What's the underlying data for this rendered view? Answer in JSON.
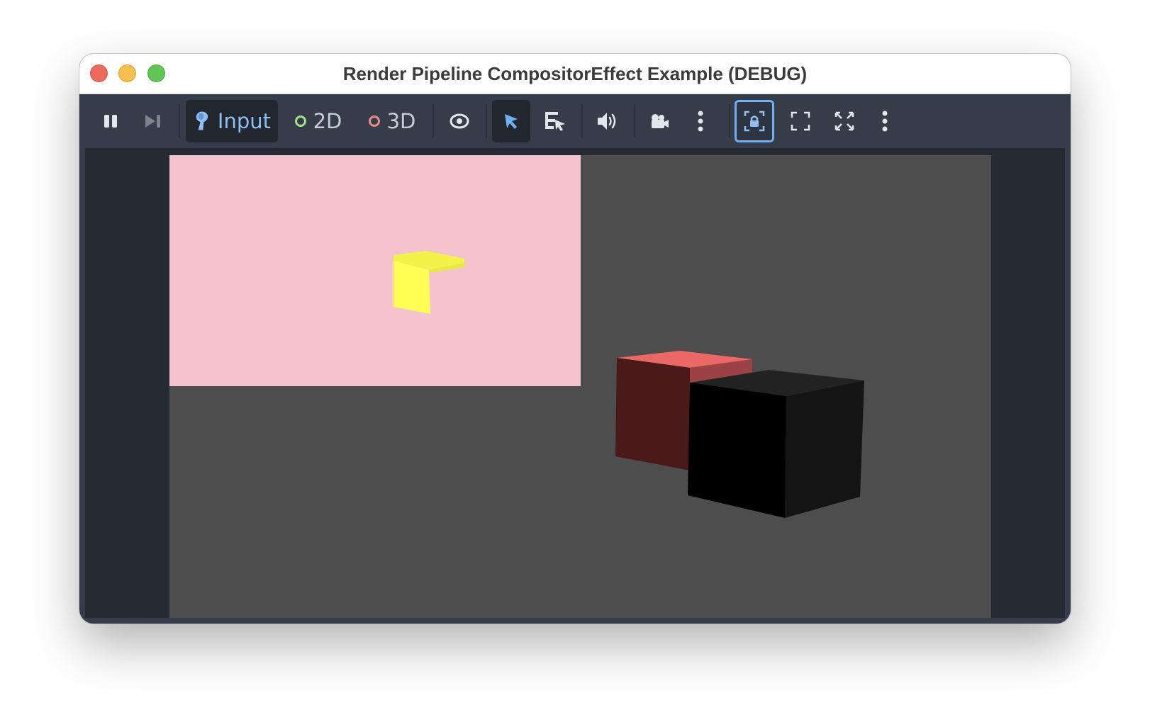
{
  "window": {
    "title": "Render Pipeline CompositorEffect Example (DEBUG)"
  },
  "toolbar": {
    "pause_icon": "pause-icon",
    "next_frame_icon": "next-frame-icon",
    "input_label": "Input",
    "mode_2d_label": "2D",
    "mode_3d_label": "3D",
    "colors": {
      "accent": "#70b0f2",
      "ring_2d": "#a6e08a",
      "ring_3d": "#f08a8a",
      "toolbar_bg": "#363d4a",
      "active_bg": "#21262f"
    }
  },
  "scene": {
    "background_color": "#4d4d4d",
    "overlay_color": "#f5c3cd",
    "yellow_shape_color": "#ffff55",
    "red_cube_color": "#ea6967",
    "black_cube_color": "#000000"
  }
}
